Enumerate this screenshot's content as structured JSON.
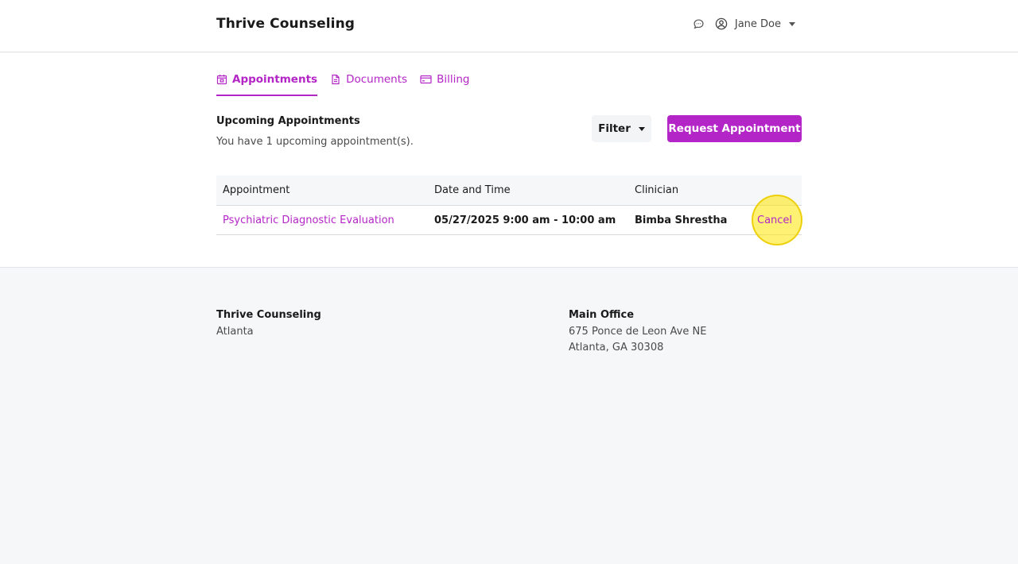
{
  "header": {
    "brand": "Thrive Counseling",
    "user_name": "Jane Doe"
  },
  "tabs": [
    {
      "label": "Appointments",
      "icon": "calendar-icon",
      "active": true
    },
    {
      "label": "Documents",
      "icon": "document-icon",
      "active": false
    },
    {
      "label": "Billing",
      "icon": "credit-card-icon",
      "active": false
    }
  ],
  "section": {
    "title": "Upcoming Appointments",
    "subtitle": "You have 1 upcoming appointment(s).",
    "filter_label": "Filter",
    "request_label": "Request Appointment"
  },
  "table": {
    "headers": [
      "Appointment",
      "Date and Time",
      "Clinician"
    ],
    "rows": [
      {
        "appointment": "Psychiatric Diagnostic Evaluation",
        "datetime": "05/27/2025 9:00 am - 10:00 am",
        "clinician": "Bimba Shrestha",
        "action": "Cancel"
      }
    ]
  },
  "footer": {
    "left": {
      "title": "Thrive Counseling",
      "line1": "Atlanta"
    },
    "right": {
      "title": "Main Office",
      "line1": "675 Ponce de Leon Ave NE",
      "line2": "Atlanta, GA 30308"
    }
  },
  "colors": {
    "accent": "#b325c6",
    "page_bg": "#f6f7f9",
    "highlight": "#ffe600"
  }
}
